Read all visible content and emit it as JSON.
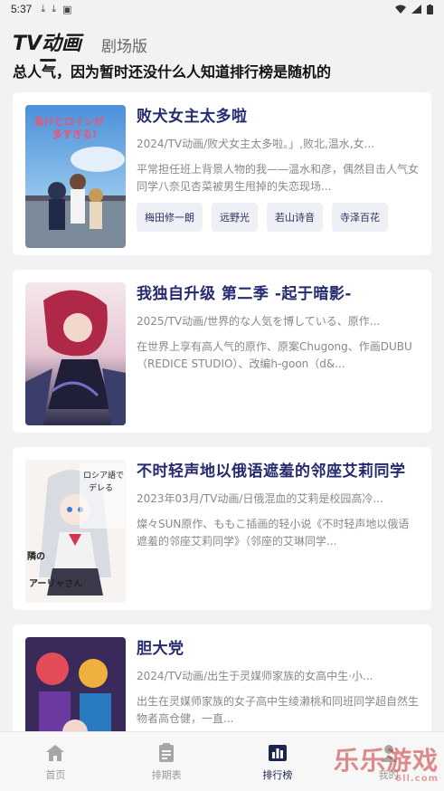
{
  "status": {
    "time": "5:37",
    "icons": [
      "download-icon",
      "download-icon",
      "app-icon",
      "wifi-icon",
      "signal-icon",
      "battery-icon"
    ]
  },
  "tabs": [
    {
      "label": "TV动画",
      "active": true
    },
    {
      "label": "剧场版",
      "active": false
    }
  ],
  "notice": "总人气，因为暂时还没什么人知道排行榜是随机的",
  "items": [
    {
      "title": "败犬女主太多啦",
      "meta": "2024/TV动画/败犬女主太多啦。」,败北,温水,女...",
      "desc": "平常担任班上背景人物的我——温水和彦，偶然目击人气女同学八奈见杏菜被男生甩掉的失恋现场...",
      "staff": [
        "梅田修一朗",
        "远野光",
        "若山诗音",
        "寺泽百花"
      ]
    },
    {
      "title": "我独自升级 第二季 -起于暗影-",
      "meta": "2025/TV动画/世界的な人気を博している、原作...",
      "desc": "在世界上享有高人气的原作、原案Chugong、作画DUBU（REDICE STUDIO）、改编h-goon（d&...",
      "staff": []
    },
    {
      "title": "不时轻声地以俄语遮羞的邻座艾莉同学",
      "meta": "2023年03月/TV动画/日俄混血的艾莉是校园高冷...",
      "desc": "燦々SUN原作、ももこ插画的轻小说《不时轻声地以俄语遮羞的邻座艾莉同学》（邻座的艾琳同学...",
      "staff": []
    },
    {
      "title": "胆大党",
      "meta": "2024/TV动画/出生于灵媒师家族的女高中生·小...",
      "desc": "出生在灵媒师家族的女子高中生绫濑桃和同班同学超自然生物者高仓健，一直...",
      "staff": []
    }
  ],
  "nav": [
    {
      "label": "首页",
      "icon": "home-icon",
      "active": false
    },
    {
      "label": "排期表",
      "icon": "clipboard-icon",
      "active": false
    },
    {
      "label": "排行榜",
      "icon": "bar-chart-icon",
      "active": true
    },
    {
      "label": "我的",
      "icon": "user-icon",
      "active": false
    }
  ],
  "watermark": {
    "text": "乐乐游戏",
    "sub": "6ll.com"
  },
  "colors": {
    "accent": "#262a6e",
    "background": "#f2f2f4",
    "card": "#ffffff"
  }
}
